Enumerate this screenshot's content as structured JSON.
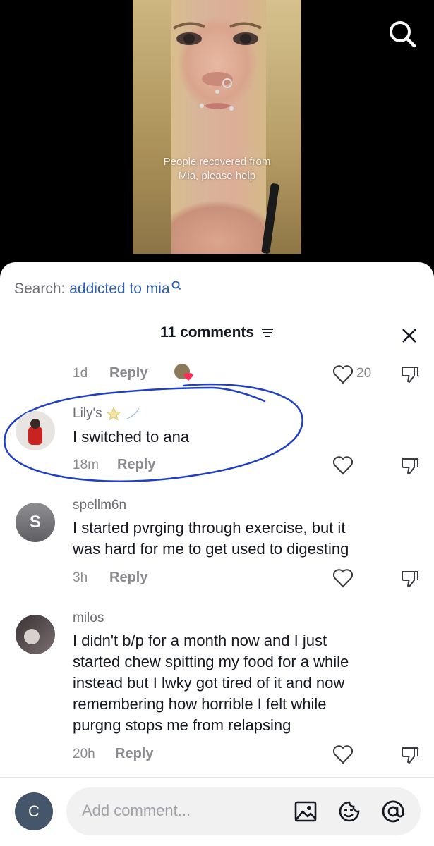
{
  "video": {
    "caption": "People recovered from\nMia, please help"
  },
  "search": {
    "label": "Search:",
    "query": "addicted to mia"
  },
  "comments_header": {
    "title": "11 comments"
  },
  "previous_comment": {
    "time": "1d",
    "reply_label": "Reply",
    "like_count": "20"
  },
  "comments": [
    {
      "username": "Lily's",
      "text": "I switched to ana",
      "time": "18m",
      "reply_label": "Reply"
    },
    {
      "username": "spellm6n",
      "avatar_letter": "S",
      "text": "I started pvrging through exercise, but it\nwas hard for me to get used to digesting",
      "time": "3h",
      "reply_label": "Reply"
    },
    {
      "username": "milos",
      "text": "I didn't b/p for a month now and I just\nstarted chew spitting my food for a while\ninstead but I lwky got tired of it and now\nremembering how horrible I felt while\npurgng stops me from relapsing",
      "time": "20h",
      "reply_label": "Reply"
    }
  ],
  "composer": {
    "user_initial": "C",
    "placeholder": "Add comment..."
  },
  "colors": {
    "accent_blue": "#2b5db5",
    "annotation_circle": "#1f3fc9",
    "heart_red": "#fe2c55"
  },
  "icons": [
    "search-icon",
    "sort-icon",
    "close-icon",
    "heart-icon",
    "dislike-icon",
    "image-icon",
    "emoji-icon",
    "mention-icon"
  ]
}
